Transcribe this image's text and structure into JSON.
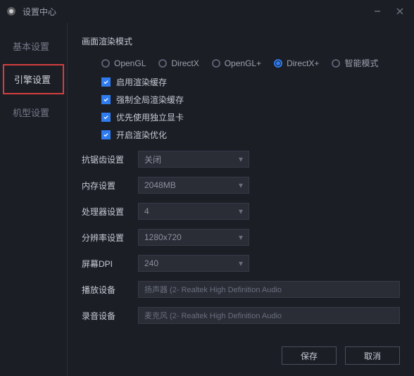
{
  "window": {
    "title": "设置中心"
  },
  "sidebar": {
    "items": [
      {
        "label": "基本设置",
        "active": false
      },
      {
        "label": "引擎设置",
        "active": true
      },
      {
        "label": "机型设置",
        "active": false
      }
    ]
  },
  "render_mode": {
    "section_label": "画面渲染模式",
    "options": [
      {
        "label": "OpenGL",
        "selected": false
      },
      {
        "label": "DirectX",
        "selected": false
      },
      {
        "label": "OpenGL+",
        "selected": false
      },
      {
        "label": "DirectX+",
        "selected": true
      },
      {
        "label": "智能模式",
        "selected": false
      }
    ],
    "checkboxes": [
      {
        "label": "启用渲染缓存",
        "checked": true
      },
      {
        "label": "强制全局渲染缓存",
        "checked": true
      },
      {
        "label": "优先使用独立显卡",
        "checked": true
      },
      {
        "label": "开启渲染优化",
        "checked": true
      }
    ]
  },
  "settings": {
    "antialias": {
      "label": "抗锯齿设置",
      "value": "关闭"
    },
    "memory": {
      "label": "内存设置",
      "value": "2048MB"
    },
    "cpu": {
      "label": "处理器设置",
      "value": "4"
    },
    "resolution": {
      "label": "分辨率设置",
      "value": "1280x720"
    },
    "dpi": {
      "label": "屏幕DPI",
      "value": "240"
    },
    "playback": {
      "label": "播放设备",
      "value": "扬声器 (2- Realtek High Definition Audio"
    },
    "recording": {
      "label": "录音设备",
      "value": "麦克风 (2- Realtek High Definition Audio"
    }
  },
  "footer": {
    "save": "保存",
    "cancel": "取消"
  }
}
